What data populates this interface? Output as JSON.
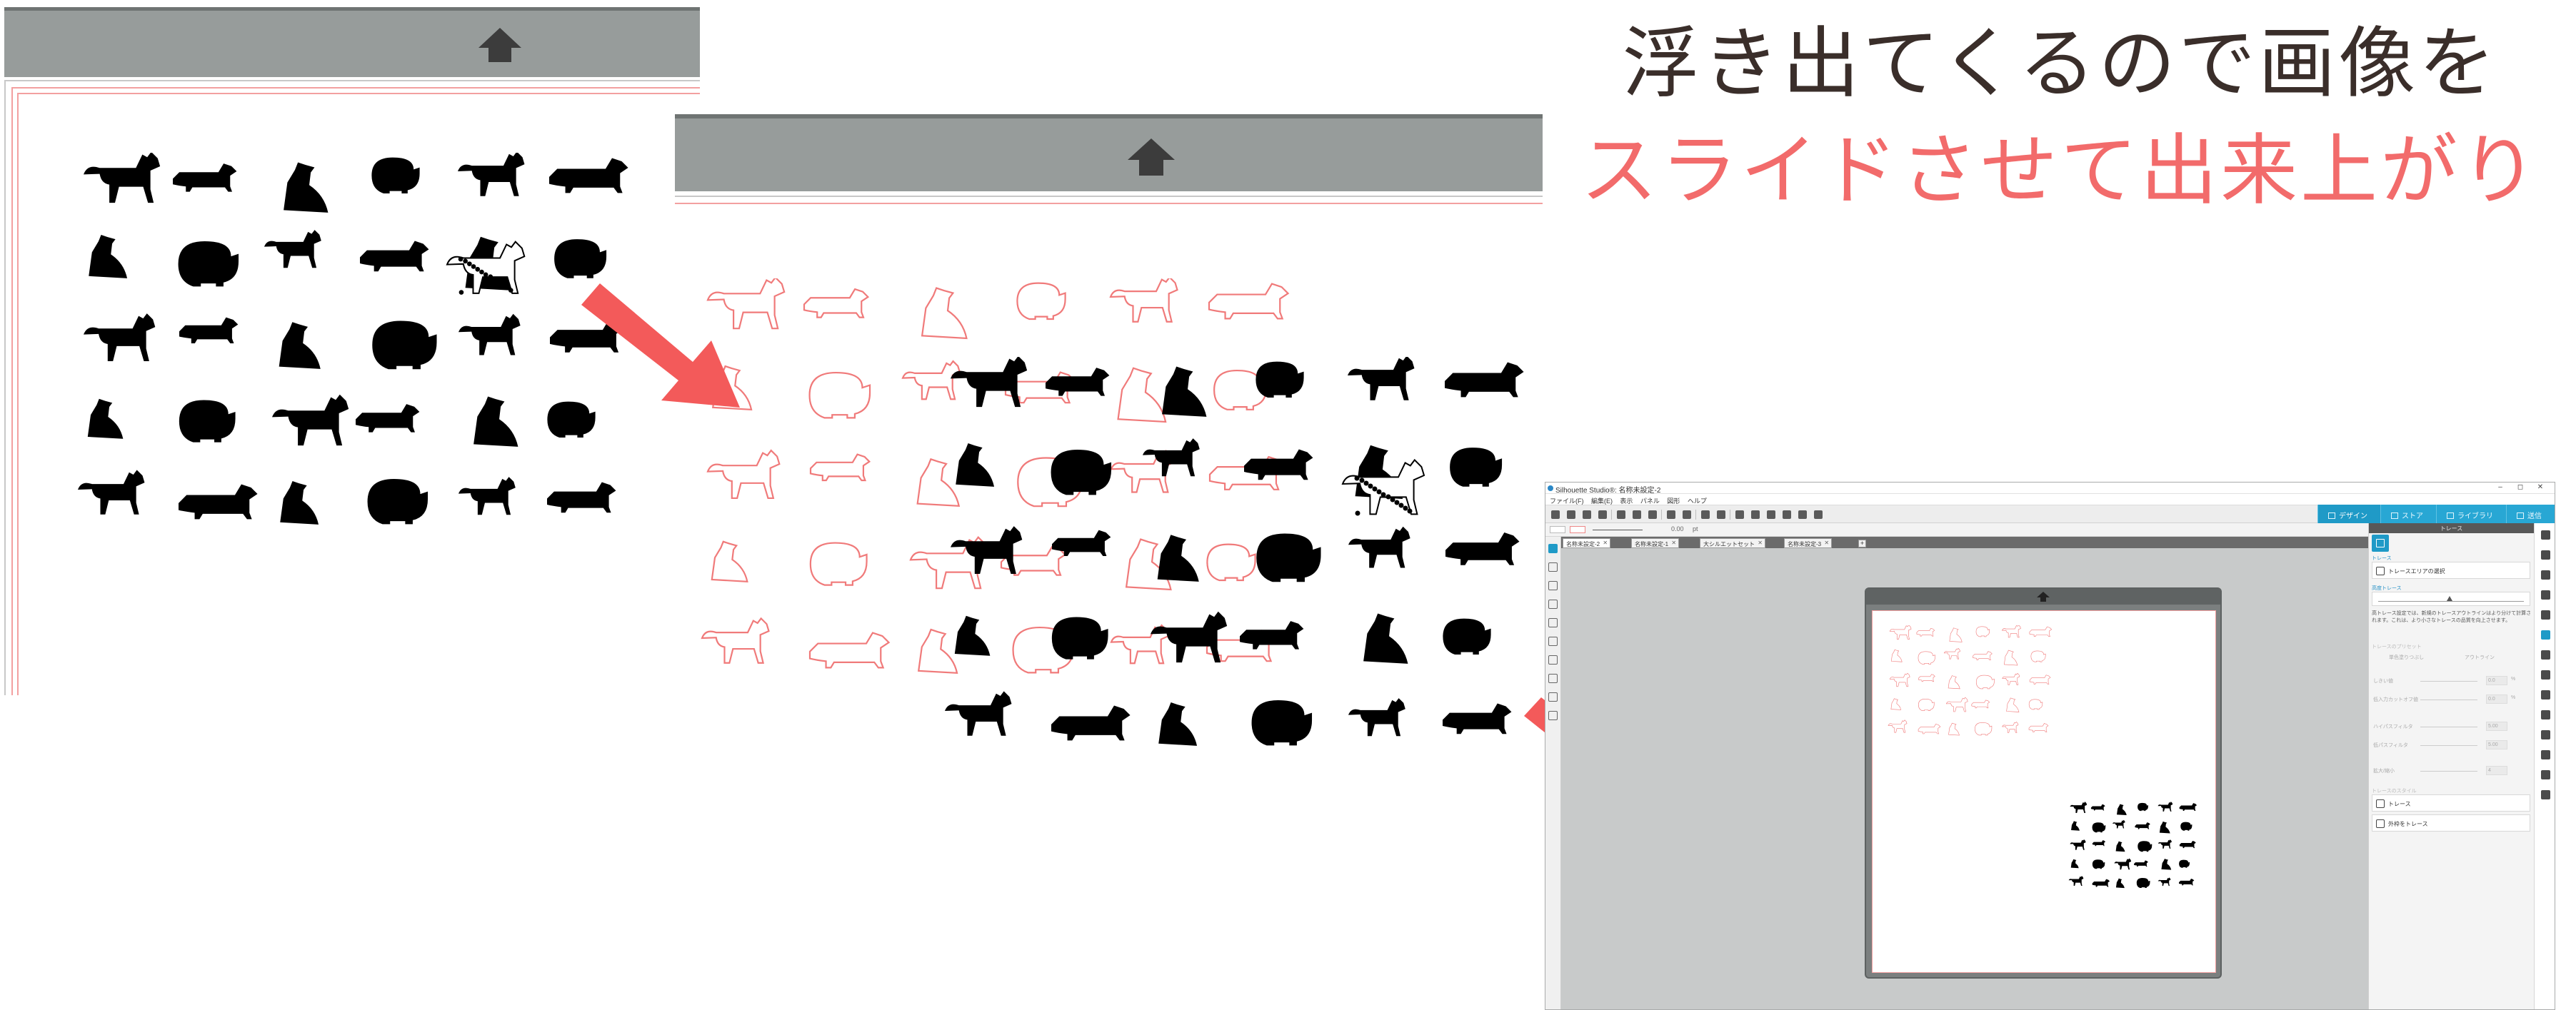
{
  "caption": {
    "line1": "浮き出てくるので画像を",
    "line2": "スライドさせて出来上がり"
  },
  "colors": {
    "caption_dark": "#3a2e2a",
    "caption_red": "#f26b6b",
    "arrow_red": "#f35a5a",
    "scroll_grey": "#979c9b",
    "accent_blue": "#1f9ac7",
    "trace_outline": "#f07a7a"
  },
  "panels": {
    "panel1": {
      "icon": "up-arrow-icon"
    },
    "panel2": {
      "icon": "up-arrow-icon"
    }
  },
  "app": {
    "title": "Silhouette Studio®: 名称未設定-2",
    "window_buttons": [
      "–",
      "◻",
      "✕"
    ],
    "menu": [
      "ファイル(F)",
      "編集(E)",
      "表示",
      "パネル",
      "図形",
      "ヘルプ"
    ],
    "top_tabs": [
      {
        "label": "デザイン",
        "icon": "design-icon"
      },
      {
        "label": "ストア",
        "icon": "store-icon"
      },
      {
        "label": "ライブラリ",
        "icon": "library-icon"
      },
      {
        "label": "送信",
        "icon": "send-icon"
      }
    ],
    "options": {
      "stroke_value": "0.00",
      "unit": "pt"
    },
    "doc_tabs": [
      "名称未設定-2",
      "名称未設定-1",
      "大シルエットセット",
      "名称未設定-3"
    ],
    "trace_panel": {
      "header": "トレース",
      "section_trace": "トレース",
      "select_area_label": "トレースエリアの選択",
      "threshold_label": "高度トレース",
      "desc": "高トレース設定では、新規のトレースアウトラインはより分けて計算されます。これは、より小さなトレースの品質を向上させます。",
      "trace_mode_label": "トレースのプリセット",
      "btn_simple": "単色塗りつぶし",
      "btn_outline": "アウトライン",
      "rows": [
        {
          "label": "しきい値",
          "value": "0.0",
          "unit": "%"
        },
        {
          "label": "低入力カットオフ値",
          "value": "0.0",
          "unit": "%"
        },
        {
          "label": "ハイパスフィルタ",
          "value": "5.00",
          "unit": ""
        },
        {
          "label": "低パスフィルタ",
          "value": "5.00",
          "unit": ""
        },
        {
          "label": "拡大/縮小",
          "value": "4",
          "unit": ""
        }
      ],
      "trace_style_label": "トレースのスタイル",
      "btn_trace": "トレース",
      "btn_outer": "外枠をトレース"
    }
  }
}
